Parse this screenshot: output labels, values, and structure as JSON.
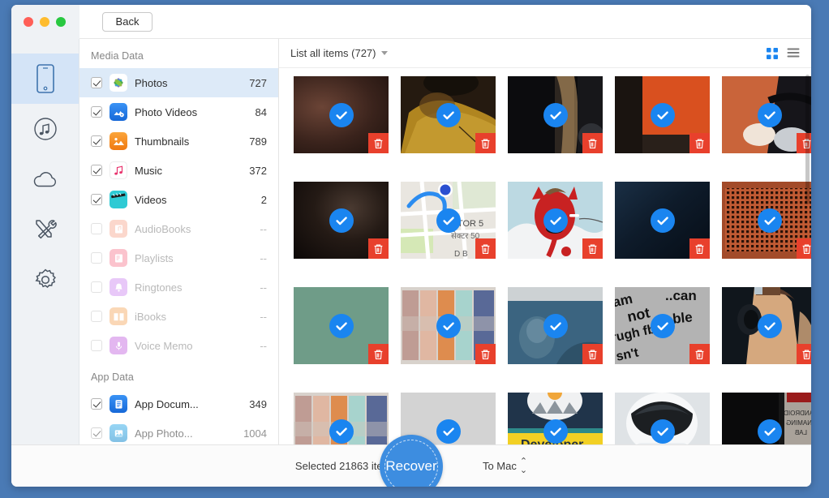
{
  "window": {
    "traffic_lights": [
      "close",
      "minimize",
      "zoom"
    ],
    "back_label": "Back"
  },
  "rail": {
    "items": [
      {
        "name": "device",
        "icon": "phone-icon",
        "active": true
      },
      {
        "name": "music",
        "icon": "music-icon",
        "active": false
      },
      {
        "name": "cloud",
        "icon": "cloud-icon",
        "active": false
      },
      {
        "name": "toolkit",
        "icon": "tools-icon",
        "active": false
      },
      {
        "name": "settings",
        "icon": "gear-icon",
        "active": false
      }
    ]
  },
  "sidebar": {
    "sections": [
      {
        "title": "Media Data",
        "items": [
          {
            "label": "Photos",
            "count": "727",
            "checked": true,
            "enabled": true,
            "selected": true,
            "icon": "photos-icon",
            "color": "#ffffff"
          },
          {
            "label": "Photo Videos",
            "count": "84",
            "checked": true,
            "enabled": true,
            "selected": false,
            "icon": "photo-videos-icon",
            "color": "#2a7ef0"
          },
          {
            "label": "Thumbnails",
            "count": "789",
            "checked": true,
            "enabled": true,
            "selected": false,
            "icon": "thumbnails-icon",
            "color": "#f5861f"
          },
          {
            "label": "Music",
            "count": "372",
            "checked": true,
            "enabled": true,
            "selected": false,
            "icon": "music-note-icon",
            "color": "#ffffff"
          },
          {
            "label": "Videos",
            "count": "2",
            "checked": true,
            "enabled": true,
            "selected": false,
            "icon": "clapper-icon",
            "color": "#2ecad4"
          },
          {
            "label": "AudioBooks",
            "count": "--",
            "checked": false,
            "enabled": false,
            "selected": false,
            "icon": "audiobooks-icon",
            "color": "#f4a08a"
          },
          {
            "label": "Playlists",
            "count": "--",
            "checked": false,
            "enabled": false,
            "selected": false,
            "icon": "playlists-icon",
            "color": "#f4738c"
          },
          {
            "label": "Ringtones",
            "count": "--",
            "checked": false,
            "enabled": false,
            "selected": false,
            "icon": "ringtones-icon",
            "color": "#c97bf0"
          },
          {
            "label": "iBooks",
            "count": "--",
            "checked": false,
            "enabled": false,
            "selected": false,
            "icon": "ibooks-icon",
            "color": "#f5a15a"
          },
          {
            "label": "Voice Memo",
            "count": "--",
            "checked": false,
            "enabled": false,
            "selected": false,
            "icon": "voice-memo-icon",
            "color": "#c262e0"
          }
        ]
      },
      {
        "title": "App Data",
        "items": [
          {
            "label": "App Docum...",
            "count": "349",
            "checked": true,
            "enabled": true,
            "selected": false,
            "icon": "app-documents-icon",
            "color": "#1f7ae0"
          },
          {
            "label": "App Photo...",
            "count": "1004",
            "checked": true,
            "enabled": true,
            "selected": false,
            "icon": "app-photos-icon",
            "color": "#2ba8e0"
          }
        ]
      }
    ]
  },
  "toolbar": {
    "list_filter_label": "List all items (727)",
    "grid_view_active": true,
    "grid_view_name": "grid-view",
    "list_view_name": "list-view",
    "accent_color": "#1a85f0"
  },
  "gallery": {
    "columns": 5,
    "check_color": "#1a85f0",
    "delete_color": "#e8402c",
    "thumbs": [
      {
        "alt": "dark skin closeup",
        "checked": true,
        "kind": "dark-brown"
      },
      {
        "alt": "golden texture closeup",
        "checked": true,
        "kind": "gold"
      },
      {
        "alt": "person with dark hair",
        "checked": true,
        "kind": "hair"
      },
      {
        "alt": "orange wall",
        "checked": true,
        "kind": "orange"
      },
      {
        "alt": "blurred hand with glasses",
        "checked": true,
        "kind": "hand"
      },
      {
        "alt": "dark blurred photo",
        "checked": true,
        "kind": "near-black"
      },
      {
        "alt": "map screenshot",
        "checked": true,
        "kind": "map",
        "text1": "CTOR 5",
        "text2": "सेक्टर 50",
        "text3": "D B"
      },
      {
        "alt": "red cartoon devil",
        "checked": true,
        "kind": "devil"
      },
      {
        "alt": "dark blue gradient",
        "checked": true,
        "kind": "navy"
      },
      {
        "alt": "red dotted mesh pattern",
        "checked": true,
        "kind": "mesh"
      },
      {
        "alt": "solid green screen",
        "checked": true,
        "kind": "green"
      },
      {
        "alt": "blurred people collage",
        "checked": true,
        "kind": "collage"
      },
      {
        "alt": "blue toned portrait",
        "checked": true,
        "kind": "blueportrait"
      },
      {
        "alt": "text screenshot",
        "checked": true,
        "kind": "texty",
        "text1": "am",
        "text2": "..can",
        "text3": "not",
        "text4": "able",
        "text5": "rugh fb...",
        "text6": "sn't"
      },
      {
        "alt": "man wearing headphones",
        "checked": true,
        "kind": "headphones"
      },
      {
        "alt": "blurred people collage",
        "checked": true,
        "kind": "collage"
      },
      {
        "alt": "light gray blank",
        "checked": true,
        "kind": "lightgray"
      },
      {
        "alt": "developer banner",
        "checked": true,
        "kind": "developer",
        "text1": "Developer"
      },
      {
        "alt": "astronaut helmet",
        "checked": true,
        "kind": "astronaut"
      },
      {
        "alt": "dark sign photo",
        "checked": true,
        "kind": "signboard",
        "text1": "ANDROID",
        "text2": "NAMING",
        "text3": "LAB"
      }
    ]
  },
  "footer": {
    "selected_text": "Selected 21863 items",
    "recover_label": "Recover",
    "destination_label": "To Mac",
    "recover_color": "#3d8de0"
  }
}
